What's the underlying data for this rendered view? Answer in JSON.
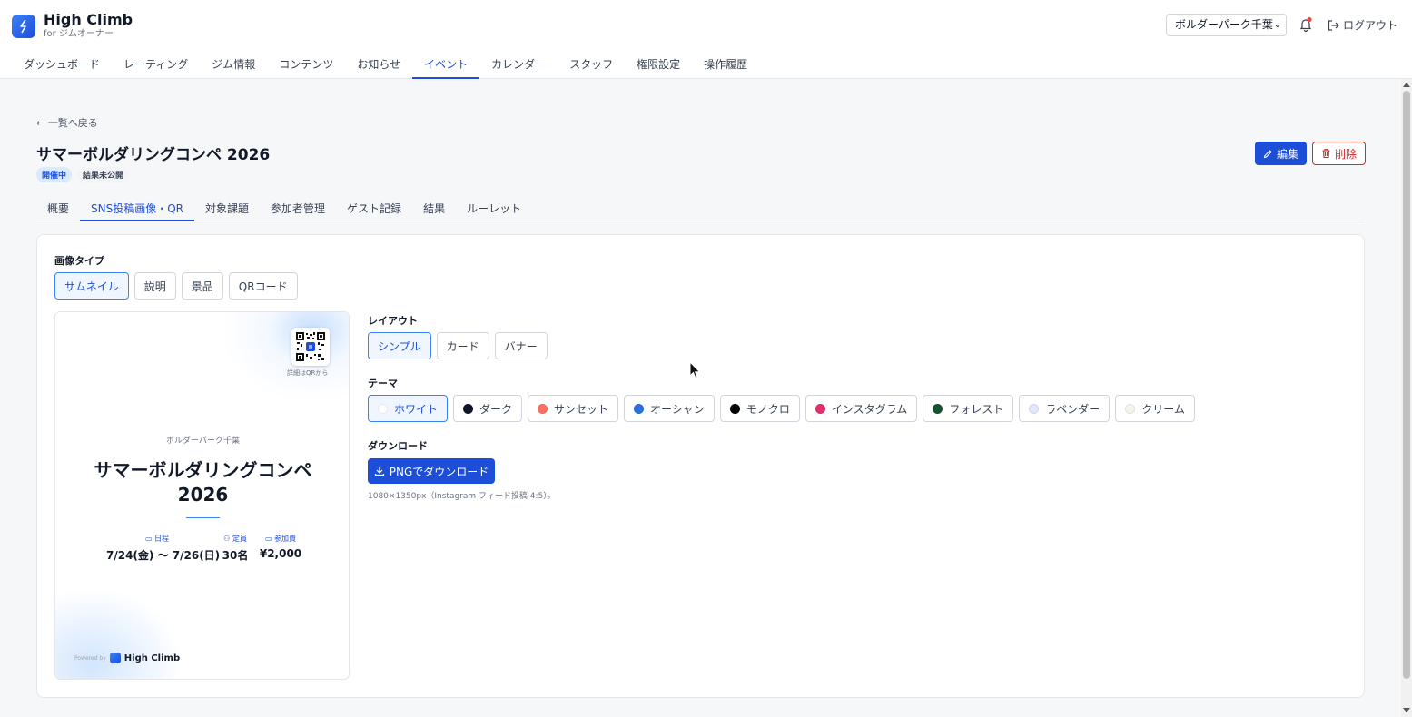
{
  "app": {
    "name": "High Climb",
    "subtitle": "for ジムオーナー"
  },
  "nav": {
    "items": [
      {
        "label": "ダッシュボード"
      },
      {
        "label": "レーティング"
      },
      {
        "label": "ジム情報"
      },
      {
        "label": "コンテンツ"
      },
      {
        "label": "お知らせ"
      },
      {
        "label": "イベント",
        "active": true
      },
      {
        "label": "カレンダー"
      },
      {
        "label": "スタッフ"
      },
      {
        "label": "権限設定"
      },
      {
        "label": "操作履歴"
      }
    ]
  },
  "header": {
    "gym_select": "ボルダーパーク千葉",
    "logout": "ログアウト",
    "notification_dot_color": "#ef4444"
  },
  "page": {
    "back": "一覧へ戻る",
    "title": "サマーボルダリングコンペ 2026",
    "badges": {
      "status": "開催中",
      "result": "結果未公開"
    },
    "edit": "編集",
    "delete": "削除"
  },
  "subtabs": [
    {
      "label": "概要"
    },
    {
      "label": "SNS投稿画像・QR",
      "active": true
    },
    {
      "label": "対象課題"
    },
    {
      "label": "参加者管理"
    },
    {
      "label": "ゲスト記録"
    },
    {
      "label": "結果"
    },
    {
      "label": "ルーレット"
    }
  ],
  "image_type": {
    "label": "画像タイプ",
    "options": [
      "サムネイル",
      "説明",
      "景品",
      "QRコード"
    ],
    "selected": "サムネイル"
  },
  "layout": {
    "label": "レイアウト",
    "options": [
      "シンプル",
      "カード",
      "バナー"
    ],
    "selected": "シンプル"
  },
  "theme": {
    "label": "テーマ",
    "selected": "ホワイト",
    "options": [
      {
        "label": "ホワイト",
        "color": "#ffffff"
      },
      {
        "label": "ダーク",
        "color": "#0f172a"
      },
      {
        "label": "サンセット",
        "color": "#f97362"
      },
      {
        "label": "オーシャン",
        "color": "#2f6fe0"
      },
      {
        "label": "モノクロ",
        "color": "#000000"
      },
      {
        "label": "インスタグラム",
        "color": "#e1306c"
      },
      {
        "label": "フォレスト",
        "color": "#14532d"
      },
      {
        "label": "ラベンダー",
        "color": "#e0e7ff"
      },
      {
        "label": "クリーム",
        "color": "#f5f5ea"
      }
    ]
  },
  "download": {
    "label": "ダウンロード",
    "button": "PNGでダウンロード",
    "note": "1080×1350px（Instagram フィード投稿 4:5）。"
  },
  "preview": {
    "qr_note": "詳細はQRから",
    "gym": "ボルダーパーク千葉",
    "title": "サマーボルダリングコンペ 2026",
    "schedule_label": "日程",
    "schedule_value": "7/24(金) 〜 7/26(日)",
    "capacity_label": "定員",
    "capacity_value": "30名",
    "fee_label": "参加費",
    "fee_value": "¥2,000",
    "powered_by": "Powered by",
    "brand": "High Climb"
  }
}
